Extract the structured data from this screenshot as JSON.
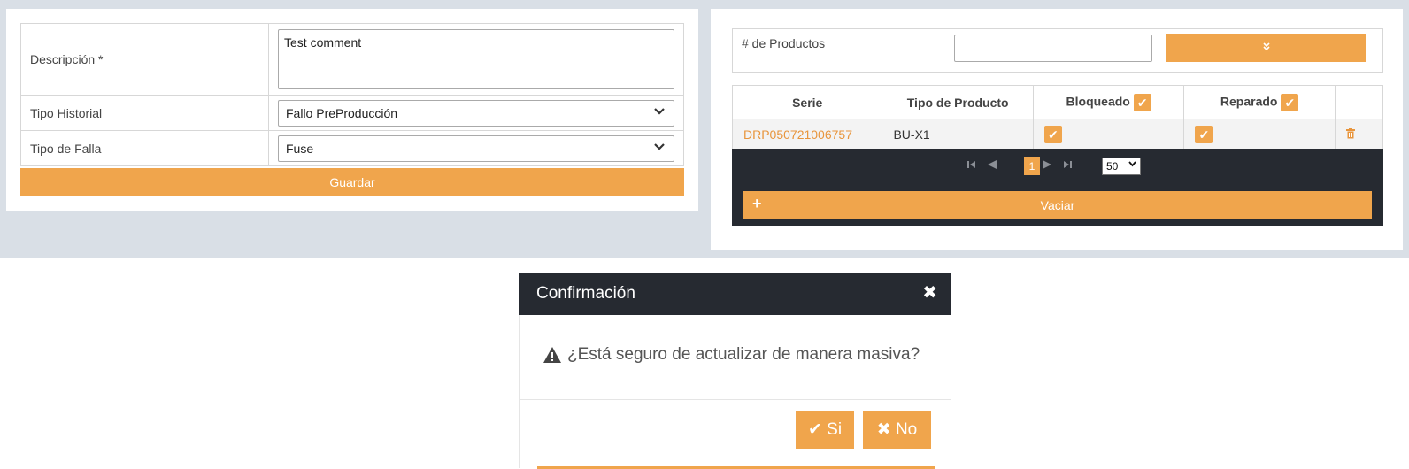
{
  "form": {
    "descripcion_label": "Descripción *",
    "descripcion_value": "Test comment",
    "tipo_historial_label": "Tipo Historial",
    "tipo_historial_value": "Fallo PreProducción",
    "tipo_falla_label": "Tipo de Falla",
    "tipo_falla_value": "Fuse",
    "save_label": "Guardar"
  },
  "products": {
    "count_label": "# de Productos",
    "count_value": "",
    "expand_icon": "double-chevron-down-icon",
    "expand_glyph": "»"
  },
  "grid": {
    "headers": {
      "serie": "Serie",
      "tipo_producto": "Tipo de Producto",
      "bloqueado": "Bloqueado",
      "reparado": "Reparado"
    },
    "rows": [
      {
        "serie": "DRP050721006757",
        "tipo_producto": "BU-X1",
        "bloqueado": true,
        "reparado": true
      }
    ],
    "check_glyph": "✔",
    "trash_glyph": "🗑"
  },
  "pager": {
    "first": "⏮",
    "prev": "◀",
    "current_page": "1",
    "next": "▶",
    "last": "⏭",
    "page_size": "50",
    "chev": "⌄"
  },
  "vaciar": {
    "label": "Vaciar",
    "plus": "+"
  },
  "modal": {
    "title": "Confirmación",
    "close": "✖",
    "warn_glyph": "⚠",
    "message": "¿Está seguro de actualizar de manera masiva?",
    "yes_label": "✔ Si",
    "no_label": "✖ No"
  },
  "colors": {
    "accent": "#f0a54c",
    "dark": "#262a31",
    "page_bg": "#d9dfe6"
  }
}
